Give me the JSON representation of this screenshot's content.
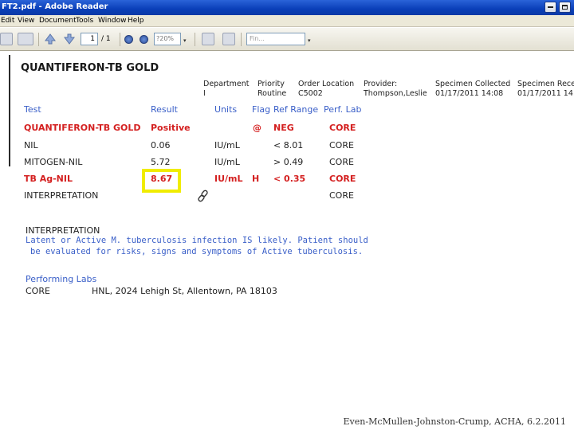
{
  "window": {
    "title": "FT2.pdf - Adobe Reader"
  },
  "menu": [
    "Edit",
    "View",
    "Document",
    "Tools",
    "Window",
    "Help"
  ],
  "toolbar": {
    "page_current": "1",
    "page_total": "/ 1",
    "zoom": "?20%",
    "find_placeholder": "Fin..."
  },
  "report": {
    "title": "QUANTIFERON-TB GOLD",
    "meta": [
      {
        "label": "Department",
        "value": "I"
      },
      {
        "label": "Priority",
        "value": "Routine"
      },
      {
        "label": "Order Location",
        "value": "C5002"
      },
      {
        "label": "Provider:",
        "value": "Thompson,Leslie"
      },
      {
        "label": "Specimen Collected",
        "value": "01/17/2011 14:08"
      },
      {
        "label": "Specimen Recei",
        "value": "01/17/2011 14:0"
      }
    ],
    "columns": [
      "Test",
      "Result",
      "Units",
      "Flag",
      "Ref Range",
      "Perf. Lab"
    ],
    "rows": [
      {
        "test": "QUANTIFERON-TB GOLD",
        "result": "Positive",
        "units": "",
        "flag": "@",
        "ref": "NEG",
        "lab": "CORE",
        "abnormal": true
      },
      {
        "test": "NIL",
        "result": "0.06",
        "units": "IU/mL",
        "flag": "",
        "ref": "< 8.01",
        "lab": "CORE",
        "abnormal": false
      },
      {
        "test": "MITOGEN-NIL",
        "result": "5.72",
        "units": "IU/mL",
        "flag": "",
        "ref": "> 0.49",
        "lab": "CORE",
        "abnormal": false
      },
      {
        "test": "TB Ag-NIL",
        "result": "8.67",
        "units": "IU/mL",
        "flag": "H",
        "ref": "< 0.35",
        "lab": "CORE",
        "abnormal": true
      },
      {
        "test": "INTERPRETATION",
        "result": "",
        "units": "",
        "flag": "",
        "ref": "",
        "lab": "CORE",
        "abnormal": false
      }
    ],
    "interpretation": {
      "heading": "INTERPRETATION",
      "line1": "Latent or Active M. tuberculosis infection IS likely.  Patient should",
      "line2": "be evaluated for risks, signs and symptoms of Active tuberculosis."
    },
    "performing_labs": {
      "heading": "Performing Labs",
      "code": "CORE",
      "address": "HNL, 2024 Lehigh St, Allentown, PA 18103"
    }
  },
  "credit": "Even-McMullen-Johnston-Crump, ACHA, 6.2.2011",
  "colors": {
    "abnormal": "#d42020",
    "header_blue": "#3a5fc8",
    "highlight": "#f0ec00",
    "titlebar": "#0a3fb8"
  }
}
